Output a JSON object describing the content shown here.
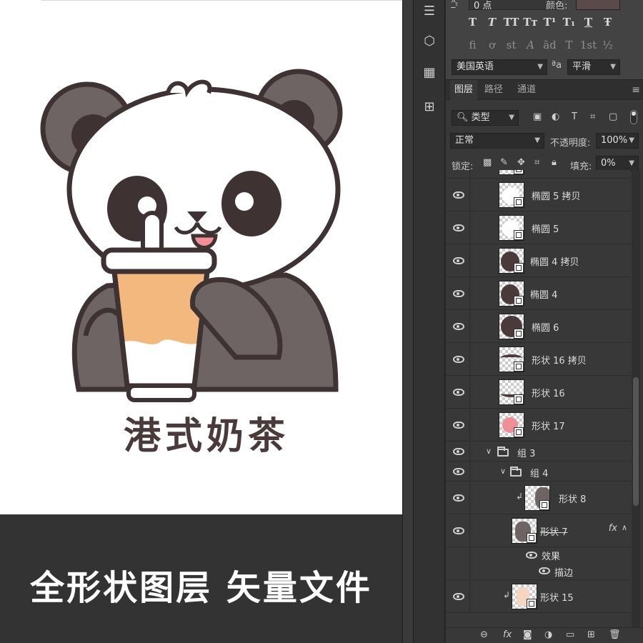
{
  "artboard": {
    "logo_text": "港式奶茶",
    "banner_text": "全形状图层 矢量文件",
    "colors": {
      "panda_dark": "#6e6464",
      "outline": "#3e3232",
      "tea": "#f2b87e",
      "tongue": "#f08f98",
      "banner": "#333333"
    }
  },
  "character_panel": {
    "tracking_value": "0 点",
    "color_label": "颜色:",
    "language": "美国英语",
    "aa_label": "ªa",
    "antialias": "平滑",
    "style_buttons": [
      "T",
      "T",
      "TT",
      "Tт",
      "T¹",
      "T₁",
      "T",
      "Ŧ"
    ],
    "opentype_buttons": [
      "fi",
      "ơ",
      "st",
      "A",
      "ād",
      "T",
      "1st",
      "½"
    ]
  },
  "layers_panel": {
    "tabs": [
      "图层",
      "路径",
      "通道"
    ],
    "filter_label": "类型",
    "blend_mode": "正常",
    "opacity_label": "不透明度:",
    "opacity_value": "100%",
    "lock_label": "锁定:",
    "fill_label": "填充:",
    "fill_value": "0%",
    "layers": [
      {
        "name": "椭圆 5 拷贝"
      },
      {
        "name": "椭圆 5"
      },
      {
        "name": "椭圆 4 拷贝"
      },
      {
        "name": "椭圆 4"
      },
      {
        "name": "椭圆 6"
      },
      {
        "name": "形状 16 拷贝"
      },
      {
        "name": "形状 16"
      },
      {
        "name": "形状 17"
      },
      {
        "name": "组 3"
      },
      {
        "name": "组 4"
      },
      {
        "name": "形状 8"
      },
      {
        "name": "形状 7",
        "fx": "fx"
      },
      {
        "name": "效果"
      },
      {
        "name": "描边"
      },
      {
        "name": "形状 15"
      }
    ]
  }
}
